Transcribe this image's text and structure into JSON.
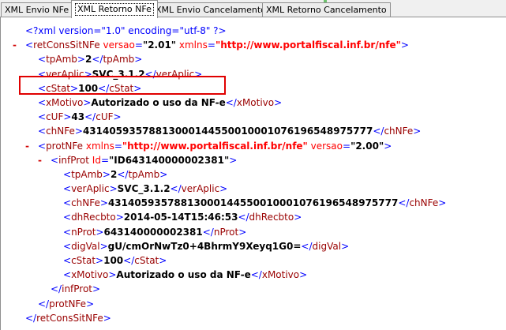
{
  "tabs": [
    {
      "label": "XML Envio NFe",
      "active": false
    },
    {
      "label": "XML Retorno NFe",
      "active": true
    },
    {
      "label": "XML Envio Cancelamento",
      "active": false
    },
    {
      "label": "XML Retorno Cancelamento",
      "active": false
    }
  ],
  "xml": {
    "declaration": "<?xml version=\"1.0\" encoding=\"utf-8\" ?>",
    "retConsSitNFe": {
      "toggle": "-",
      "tag": "retConsSitNFe",
      "attr_versao_name": "versao",
      "attr_versao_value": "\"2.01\"",
      "attr_xmlns_name": "xmlns",
      "attr_xmlns_value": "\"http://www.portalfiscal.inf.br/nfe\"",
      "tpAmb": {
        "tag": "tpAmb",
        "value": "2"
      },
      "verAplic": {
        "tag": "verAplic",
        "value": "SVC_3.1.2"
      },
      "cStat": {
        "tag": "cStat",
        "value": "100"
      },
      "xMotivo": {
        "tag": "xMotivo",
        "value": "Autorizado o uso da NF-e"
      },
      "cUF": {
        "tag": "cUF",
        "value": "43"
      },
      "chNFe": {
        "tag": "chNFe",
        "value": "43140593578813000144550010001076196548975777"
      }
    },
    "protNFe": {
      "toggle": "-",
      "tag": "protNFe",
      "attr_xmlns_name": "xmlns",
      "attr_xmlns_value": "\"http://www.portalfiscal.inf.br/nfe\"",
      "attr_versao_name": "versao",
      "attr_versao_value": "\"2.00\""
    },
    "infProt": {
      "toggle": "-",
      "tag": "infProt",
      "attr_id_name": "Id",
      "attr_id_value": "\"ID643140000002381\"",
      "tpAmb": {
        "tag": "tpAmb",
        "value": "2"
      },
      "verAplic": {
        "tag": "verAplic",
        "value": "SVC_3.1.2"
      },
      "chNFe": {
        "tag": "chNFe",
        "value": "43140593578813000144550010001076196548975777"
      },
      "dhRecbto": {
        "tag": "dhRecbto",
        "value": "2014-05-14T15:46:53"
      },
      "nProt": {
        "tag": "nProt",
        "value": "643140000002381"
      },
      "digVal": {
        "tag": "digVal",
        "value": "gU/cmOrNwTz0+4BhrmY9Xeyq1G0="
      },
      "cStat": {
        "tag": "cStat",
        "value": "100"
      },
      "xMotivo": {
        "tag": "xMotivo",
        "value": "Autorizado o uso da NF-e"
      }
    }
  },
  "colors": {
    "tag": "#0000ff",
    "tag_name": "#990000",
    "attr_name": "#ff0000",
    "highlight": "#e00000"
  }
}
